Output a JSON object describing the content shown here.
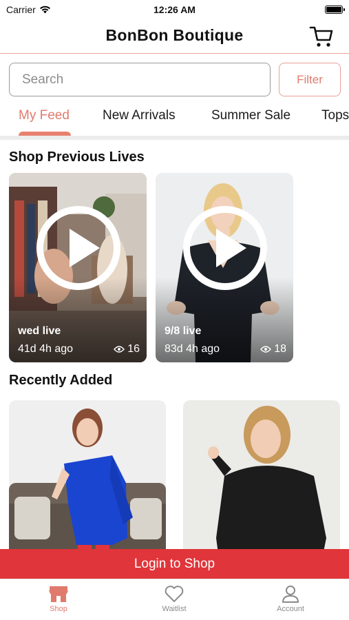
{
  "status_bar": {
    "carrier": "Carrier",
    "time": "12:26 AM"
  },
  "header": {
    "title": "BonBon Boutique",
    "cart_icon": "cart-icon"
  },
  "search": {
    "placeholder": "Search",
    "filter_label": "Filter"
  },
  "tabs": [
    {
      "label": "My Feed",
      "active": true
    },
    {
      "label": "New Arrivals",
      "active": false
    },
    {
      "label": "Summer Sale",
      "active": false
    },
    {
      "label": "Tops",
      "active": false
    }
  ],
  "sections": {
    "previous_lives_title": "Shop Previous Lives",
    "recently_added_title": "Recently Added"
  },
  "lives": [
    {
      "name": "wed live",
      "ago": "41d 4h ago",
      "views": "16"
    },
    {
      "name": "9/8 live",
      "ago": "83d 4h ago",
      "views": "18"
    }
  ],
  "login_banner": "Login to Shop",
  "bottom_nav": [
    {
      "label": "Shop",
      "icon": "store-icon",
      "active": true
    },
    {
      "label": "Waitlist",
      "icon": "heart-icon",
      "active": false
    },
    {
      "label": "Account",
      "icon": "user-icon",
      "active": false
    }
  ],
  "colors": {
    "accent": "#e07a6c",
    "banner": "#e0353a",
    "divider": "#e8a097"
  }
}
